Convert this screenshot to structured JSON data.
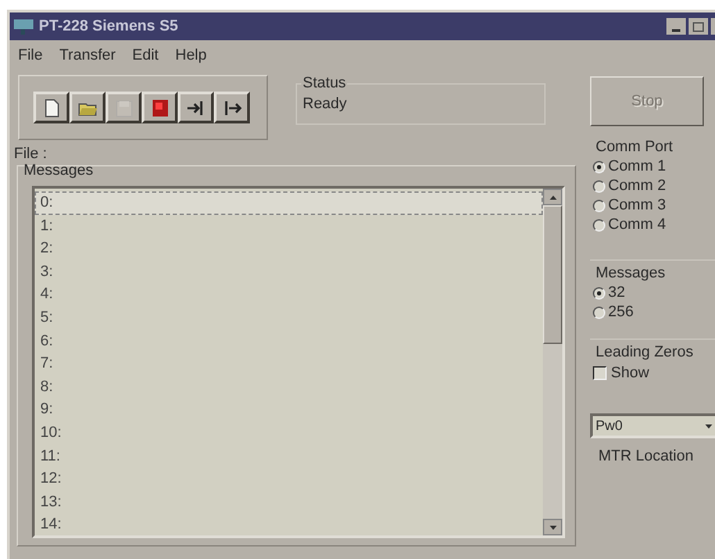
{
  "window": {
    "title": "PT-228 Siemens S5"
  },
  "menu": [
    "File",
    "Transfer",
    "Edit",
    "Help"
  ],
  "toolbar": [
    {
      "kind": "new",
      "disabled": false
    },
    {
      "kind": "open",
      "disabled": false
    },
    {
      "kind": "save",
      "disabled": true
    },
    {
      "kind": "record",
      "disabled": false
    },
    {
      "kind": "import",
      "disabled": false
    },
    {
      "kind": "export",
      "disabled": false
    }
  ],
  "status": {
    "label": "Status",
    "value": "Ready"
  },
  "stop_button": {
    "label": "Stop",
    "disabled": true
  },
  "file_label": "File :",
  "messages": {
    "label": "Messages",
    "rows": [
      {
        "text": "0:",
        "selected": true
      },
      {
        "text": "1:",
        "selected": false
      },
      {
        "text": "2:",
        "selected": false
      },
      {
        "text": "3:",
        "selected": false
      },
      {
        "text": "4:",
        "selected": false
      },
      {
        "text": "5:",
        "selected": false
      },
      {
        "text": "6:",
        "selected": false
      },
      {
        "text": "7:",
        "selected": false
      },
      {
        "text": "8:",
        "selected": false
      },
      {
        "text": "9:",
        "selected": false
      },
      {
        "text": "10:",
        "selected": false
      },
      {
        "text": "11:",
        "selected": false
      },
      {
        "text": "12:",
        "selected": false
      },
      {
        "text": "13:",
        "selected": false
      },
      {
        "text": "14:",
        "selected": false
      }
    ]
  },
  "comm_port": {
    "label": "Comm Port",
    "options": [
      {
        "label": "Comm 1",
        "selected": true
      },
      {
        "label": "Comm 2",
        "selected": false
      },
      {
        "label": "Comm 3",
        "selected": false
      },
      {
        "label": "Comm 4",
        "selected": false
      }
    ]
  },
  "message_count": {
    "label": "Messages",
    "options": [
      {
        "label": "32",
        "selected": true
      },
      {
        "label": "256",
        "selected": false
      }
    ]
  },
  "leading_zeros": {
    "label": "Leading Zeros",
    "checkbox": {
      "label": "Show",
      "checked": false
    }
  },
  "mtr_location": {
    "value": "Pw0",
    "label": "MTR Location"
  }
}
